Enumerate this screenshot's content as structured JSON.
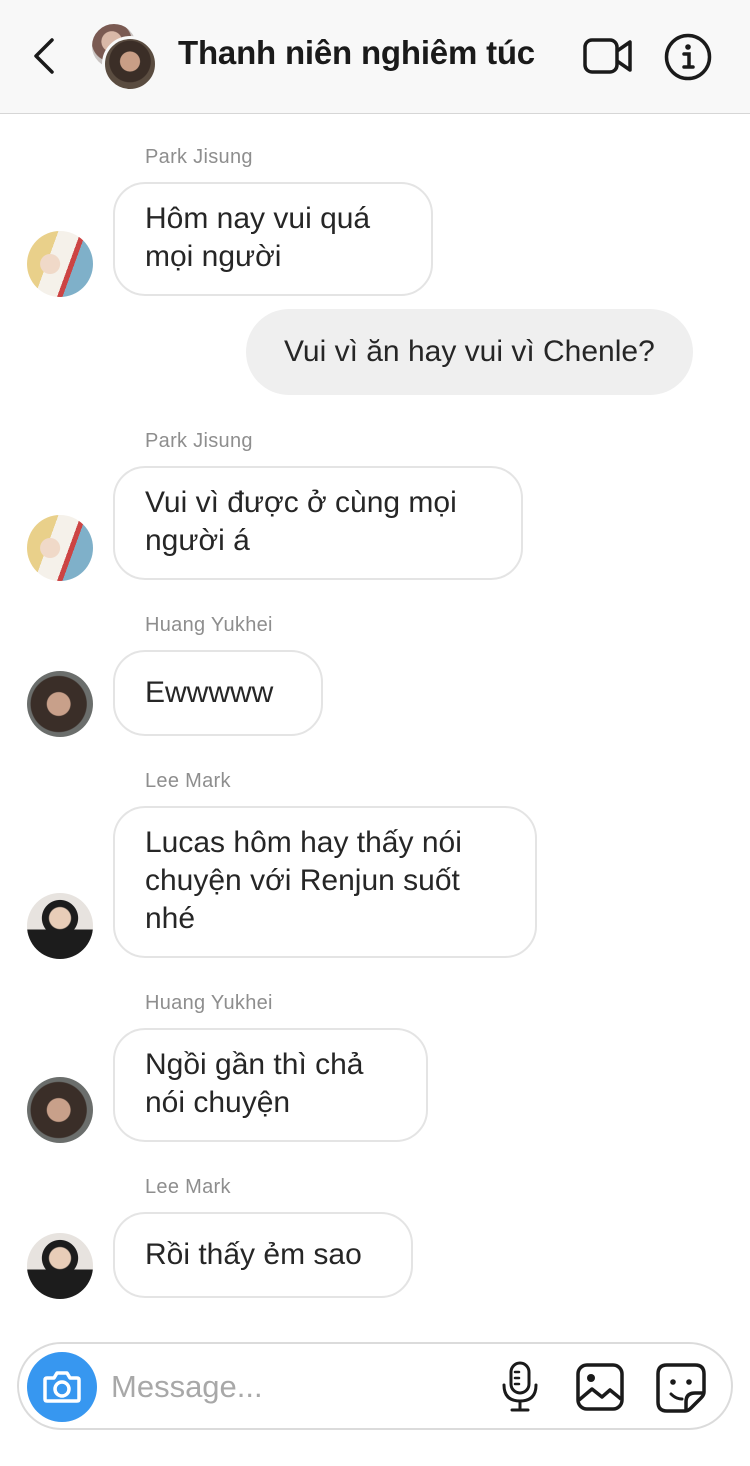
{
  "header": {
    "title": "Thanh niên nghiêm túc",
    "back_icon": "chevron-left-icon",
    "video_icon": "video-camera-icon",
    "info_icon": "info-icon"
  },
  "messages": [
    {
      "sender": "Park Jisung",
      "text": "Hôm nay vui quá\nmọi người",
      "direction": "incoming"
    },
    {
      "text": "Vui vì ăn hay vui vì Chenle?",
      "direction": "outgoing"
    },
    {
      "sender": "Park Jisung",
      "text": "Vui vì được ở cùng mọi\nngười á",
      "direction": "incoming"
    },
    {
      "sender": "Huang Yukhei",
      "text": "Ewwwww",
      "direction": "incoming"
    },
    {
      "sender": "Lee Mark",
      "text": "Lucas hôm hay thấy nói\nchuyện với Renjun suốt\nnhé",
      "direction": "incoming"
    },
    {
      "sender": "Huang Yukhei",
      "text": "Ngồi gần thì chả\nnói chuyện",
      "direction": "incoming"
    },
    {
      "sender": "Lee Mark",
      "text": "Rồi thấy ẻm sao",
      "direction": "incoming"
    }
  ],
  "composer": {
    "placeholder": "Message...",
    "camera_icon": "camera-icon",
    "mic_icon": "microphone-icon",
    "gallery_icon": "image-icon",
    "sticker_icon": "sticker-icon"
  },
  "colors": {
    "accent": "#3797f0",
    "incoming_bubble_border": "#e4e4e4",
    "outgoing_bubble": "#efefef",
    "header_bg": "#f8f8f8",
    "sender_text": "#8e8e8e"
  }
}
